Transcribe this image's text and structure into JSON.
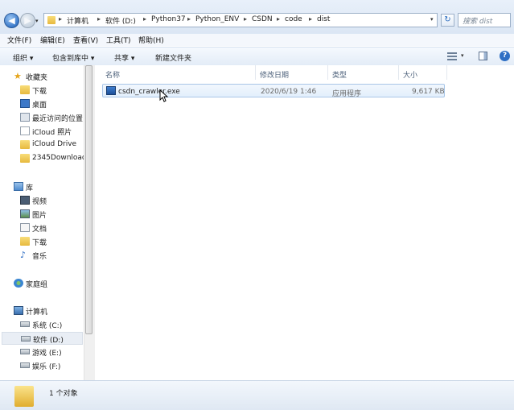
{
  "address": {
    "crumbs": [
      "计算机",
      "软件 (D:)",
      "Python37",
      "Python_ENV",
      "CSDN",
      "code",
      "dist"
    ],
    "search_placeholder": "搜索 dist"
  },
  "menu": [
    "文件(F)",
    "编辑(E)",
    "查看(V)",
    "工具(T)",
    "帮助(H)"
  ],
  "toolbar": {
    "organize": "组织 ▾",
    "include": "包含到库中 ▾",
    "share": "共享 ▾",
    "new_folder": "新建文件夹"
  },
  "nav": {
    "favorites": "收藏夹",
    "fav_items": [
      "下载",
      "桌面",
      "最近访问的位置",
      "iCloud 照片",
      "iCloud Drive",
      "2345Download"
    ],
    "libraries": "库",
    "lib_items": [
      "视频",
      "图片",
      "文档",
      "下载",
      "音乐"
    ],
    "homegroup": "家庭组",
    "computer": "计算机",
    "drives": [
      "系统 (C:)",
      "软件 (D:)",
      "游戏 (E:)",
      "娱乐 (F:)"
    ]
  },
  "columns": [
    "名称",
    "修改日期",
    "类型",
    "大小"
  ],
  "files": [
    {
      "name": "csdn_crawler.exe",
      "modified": "2020/6/19 1:46",
      "type": "应用程序",
      "size": "9,617 KB"
    }
  ],
  "status": {
    "count": "1 个对象"
  },
  "colors": {
    "accent": "#3a79c9",
    "selection": "#e3effc"
  }
}
